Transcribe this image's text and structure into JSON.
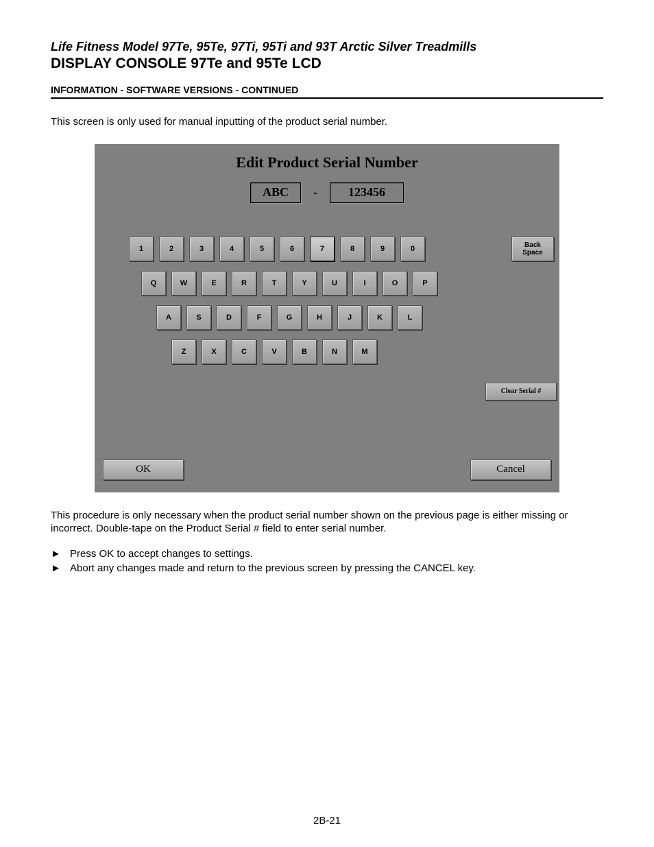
{
  "doc": {
    "title_italic": "Life Fitness Model 97Te, 95Te, 97Ti, 95Ti and 93T Arctic Silver Treadmills",
    "title": "DISPLAY CONSOLE 97Te and 95Te LCD",
    "section": "INFORMATION - SOFTWARE VERSIONS - CONTINUED",
    "intro": "This screen is only used for manual inputting of the product serial number.",
    "para_after": "This procedure is only necessary when the product serial number shown on the previous page is either missing or incorrect.  Double-tape on the Product Serial # field to enter serial number.",
    "bullet1": "Press OK to accept changes to settings.",
    "bullet2": "Abort any changes made and return to the previous screen by pressing the CANCEL key.",
    "arrow": "►",
    "page_number": "2B-21"
  },
  "screen": {
    "title": "Edit Product Serial Number",
    "field_abc": "ABC",
    "field_sep": "-",
    "field_num": "123456",
    "backspace": "Back Space",
    "clear": "Clear Serial #",
    "ok": "OK",
    "cancel": "Cancel",
    "rows": {
      "r1": [
        "1",
        "2",
        "3",
        "4",
        "5",
        "6",
        "7",
        "8",
        "9",
        "0"
      ],
      "r2": [
        "Q",
        "W",
        "E",
        "R",
        "T",
        "Y",
        "U",
        "I",
        "O",
        "P"
      ],
      "r3": [
        "A",
        "S",
        "D",
        "F",
        "G",
        "H",
        "J",
        "K",
        "L"
      ],
      "r4": [
        "Z",
        "X",
        "C",
        "V",
        "B",
        "N",
        "M"
      ]
    }
  }
}
